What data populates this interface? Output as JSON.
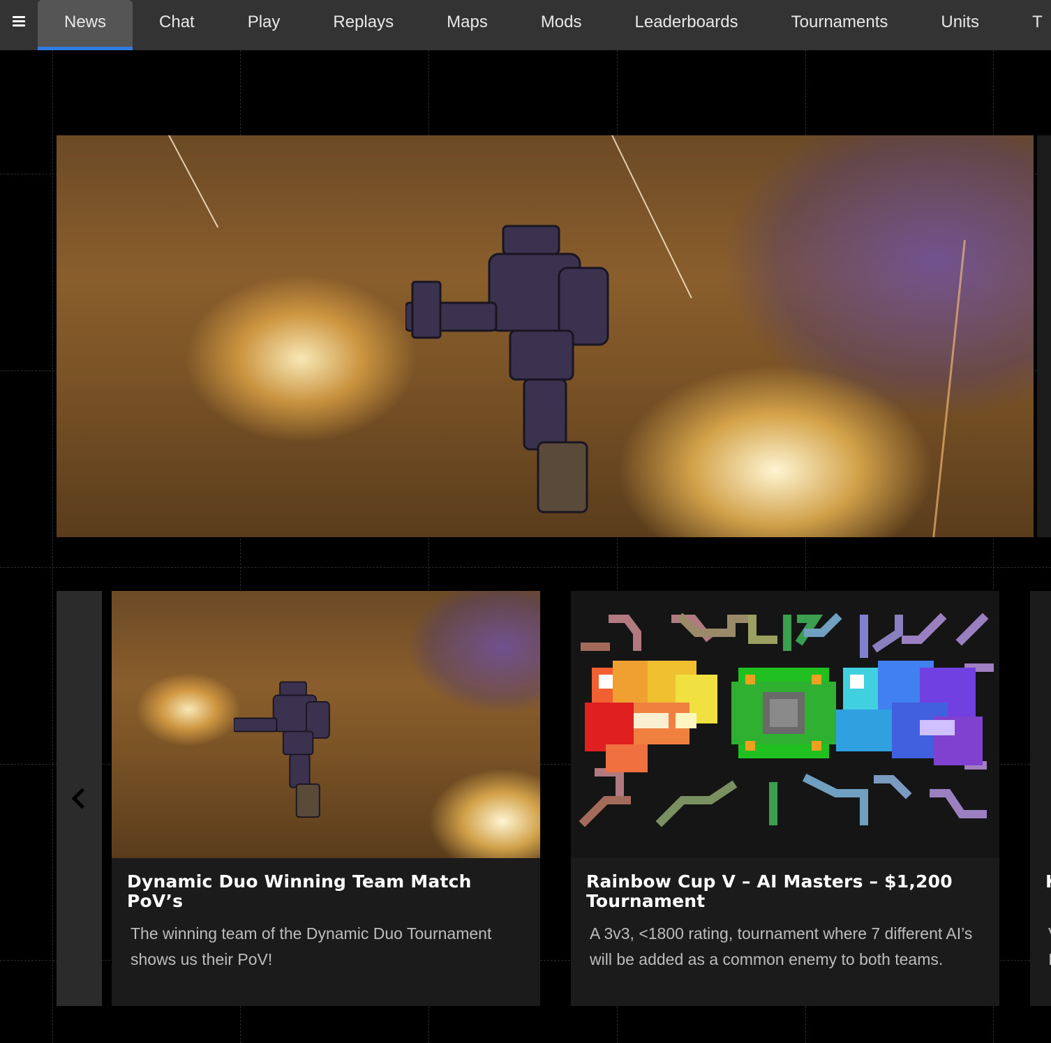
{
  "nav": {
    "tabs": [
      {
        "label": "News",
        "active": true
      },
      {
        "label": "Chat"
      },
      {
        "label": "Play"
      },
      {
        "label": "Replays"
      },
      {
        "label": "Maps"
      },
      {
        "label": "Mods"
      },
      {
        "label": "Leaderboards"
      },
      {
        "label": "Tournaments"
      },
      {
        "label": "Units"
      },
      {
        "label": "T"
      }
    ],
    "menu_icon": "hamburger-menu-icon",
    "accent_color": "#2f7be0"
  },
  "hero": {
    "image": "battle-screenshot"
  },
  "carousel": {
    "prev_icon": "chevron-left-icon",
    "cards": [
      {
        "title": "Dynamic Duo Winning Team Match PoV’s",
        "description": "The winning team of the Dynamic Duo Tournament shows us their PoV!",
        "image": "battle-screenshot"
      },
      {
        "title": "Rainbow Cup V – AI Masters – $1,200 Tournament",
        "description": "A 3v3, <1800 rating, tournament where 7 different AI’s will be added as a common enemy to both teams.",
        "image": "pixel-art-ai-masters"
      },
      {
        "title": "K",
        "description": "V I"
      }
    ]
  }
}
